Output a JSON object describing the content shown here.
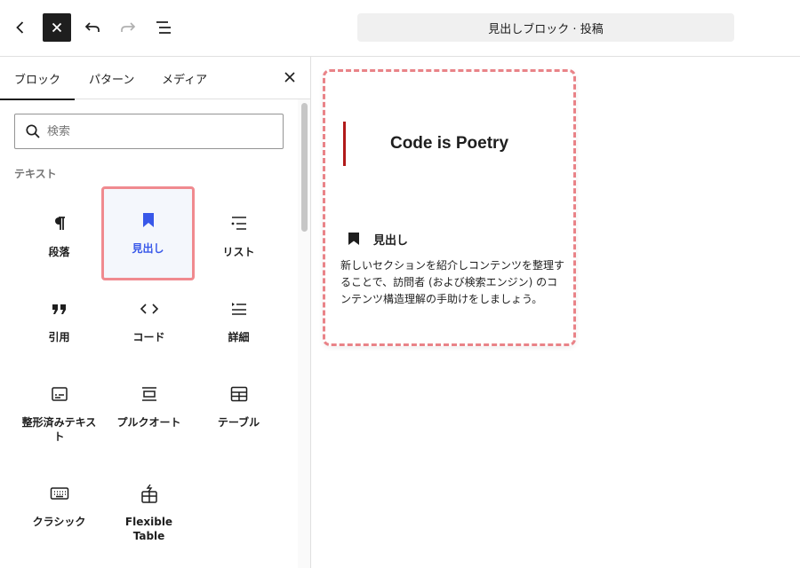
{
  "header": {
    "document_title": "見出しブロック · 投稿",
    "icons": [
      "chevron-left-icon",
      "close-icon",
      "undo-icon",
      "redo-icon",
      "list-view-icon"
    ]
  },
  "inserter": {
    "tabs": [
      {
        "label": "ブロック",
        "active": true
      },
      {
        "label": "パターン",
        "active": false
      },
      {
        "label": "メディア",
        "active": false
      }
    ],
    "search": {
      "placeholder": "検索",
      "value": ""
    },
    "category": "テキスト",
    "blocks": [
      {
        "label": "段落",
        "icon": "paragraph-icon"
      },
      {
        "label": "見出し",
        "icon": "bookmark-icon",
        "selected": true
      },
      {
        "label": "リスト",
        "icon": "list-icon"
      },
      {
        "label": "引用",
        "icon": "quote-icon"
      },
      {
        "label": "コード",
        "icon": "code-icon"
      },
      {
        "label": "詳細",
        "icon": "details-icon"
      },
      {
        "label": "整形済みテキスト",
        "icon": "preformatted-icon"
      },
      {
        "label": "プルクオート",
        "icon": "pullquote-icon"
      },
      {
        "label": "テーブル",
        "icon": "table-icon"
      },
      {
        "label": "クラシック",
        "icon": "keyboard-icon"
      },
      {
        "label": "Flexible Table",
        "icon": "flexible-table-icon"
      }
    ]
  },
  "preview": {
    "heading": "Code is Poetry",
    "block_name": "見出し",
    "description": "新しいセクションを紹介しコンテンツを整理することで、訪問者 (および検索エンジン) のコンテンツ構造理解の手助けをしましょう。"
  },
  "colors": {
    "accent": "#3858e9",
    "highlight": "#f08a8f",
    "heading_bar": "#b11a1a",
    "dark": "#1e1e1e"
  }
}
